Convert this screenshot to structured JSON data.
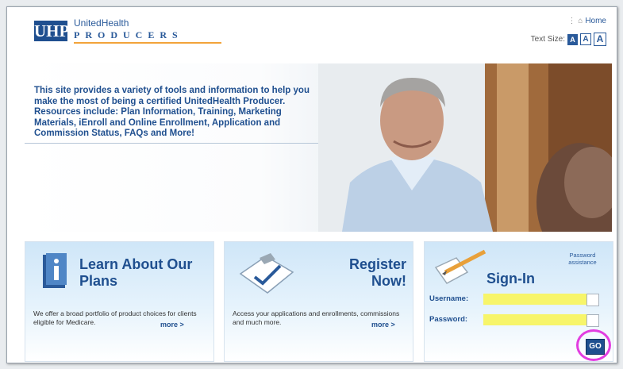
{
  "header": {
    "logo_abbr": "UHP",
    "logo_top": "UnitedHealth",
    "logo_bottom": "PRODUCERS",
    "home_link": "Home",
    "text_size_label": "Text Size:",
    "text_size_buttons": [
      "A",
      "A",
      "A"
    ]
  },
  "hero": {
    "text": "This site provides a variety of tools and information to help you make the most of being a certified UnitedHealth Producer. Resources include: Plan Information, Training, Marketing Materials, iEnroll and Online Enrollment, Application and Commission Status, FAQs and More!"
  },
  "panels": {
    "learn": {
      "title": "Learn About Our Plans",
      "desc": "We offer a broad portfolio of product choices for clients eligible for Medicare.",
      "more": "more >",
      "icon": "info-book-icon"
    },
    "register": {
      "title_line1": "Register",
      "title_line2": "Now!",
      "desc": "Access your applications and enrollments, commissions and much more.",
      "more": "more >",
      "icon": "clipboard-check-icon"
    },
    "signin": {
      "title": "Sign-In",
      "password_assistance": "Password assistance",
      "username_label": "Username:",
      "password_label": "Password:",
      "username_value": "",
      "password_value": "",
      "go": "GO",
      "icon": "notepad-pen-icon"
    }
  },
  "colors": {
    "brand_blue": "#1f4f8f",
    "accent_orange": "#f2a33a",
    "highlight_yellow": "#f7f56a",
    "annotation_magenta": "#e23de0"
  }
}
